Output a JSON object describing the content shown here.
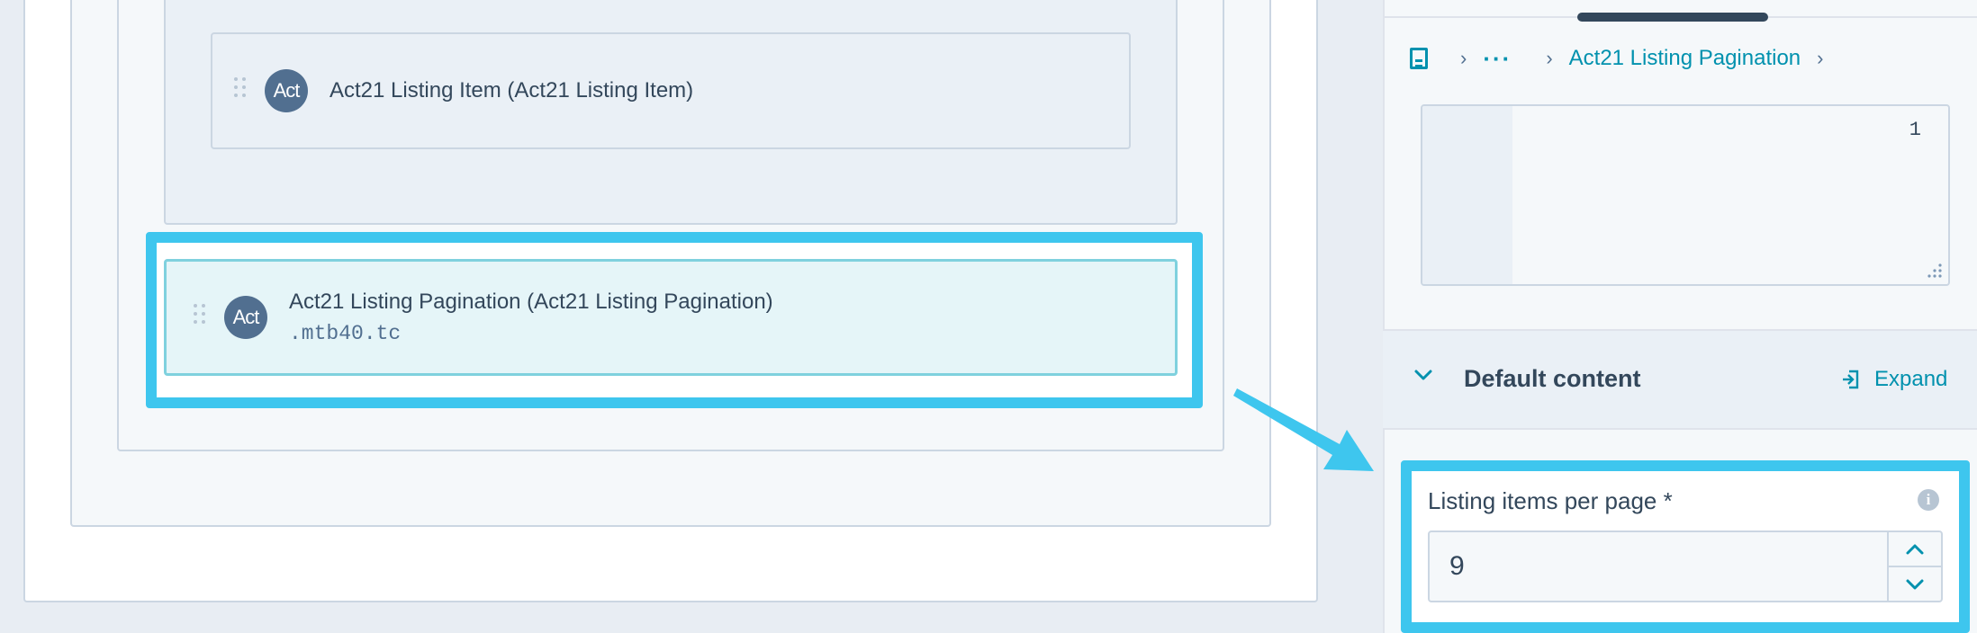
{
  "canvas": {
    "listing_item": {
      "icon_text": "Act",
      "label": "Act21 Listing Item (Act21 Listing Item)"
    },
    "pagination_module": {
      "icon_text": "Act",
      "label": "Act21 Listing Pagination (Act21 Listing Pagination)",
      "css_class": ".mtb40.tc"
    }
  },
  "panel": {
    "breadcrumb": {
      "doc_icon": "document-icon",
      "ellipsis": "···",
      "current": "Act21 Listing Pagination"
    },
    "code_editor": {
      "line_number": "1"
    },
    "default_content": {
      "title": "Default content",
      "expand_label": "Expand"
    },
    "field": {
      "label": "Listing items per page *",
      "value": "9"
    }
  },
  "colors": {
    "highlight": "#3ec6ee",
    "link": "#0091ae",
    "text": "#33475b",
    "icon_bg": "#516f90"
  }
}
